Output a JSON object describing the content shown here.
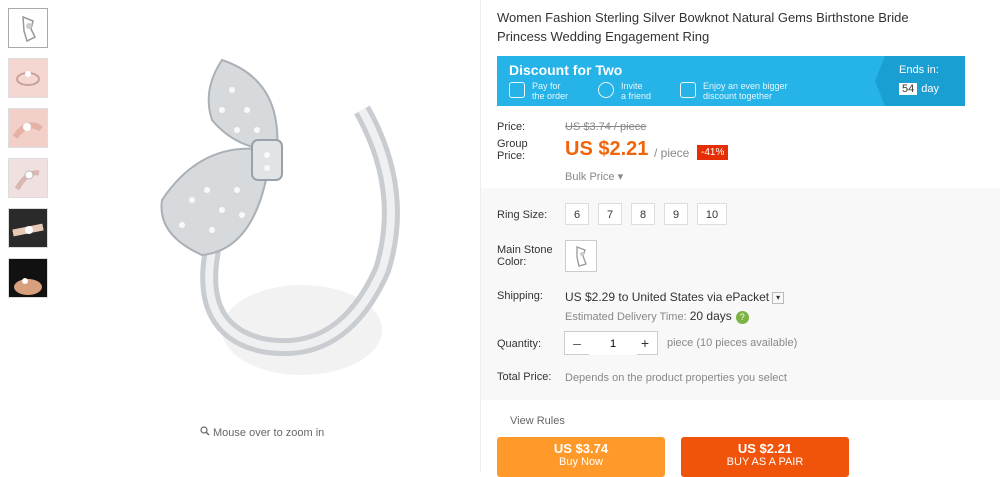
{
  "gallery": {
    "zoom_hint": "Mouse over to zoom in"
  },
  "product": {
    "title": "Women Fashion Sterling Silver Bowknot Natural Gems Birthstone Bride Princess Wedding Engagement Ring"
  },
  "promo": {
    "title": "Discount for Two",
    "steps": [
      {
        "icon": "tag-icon",
        "line1": "Pay for",
        "line2": "the order"
      },
      {
        "icon": "people-icon",
        "line1": "Invite",
        "line2": "a friend"
      },
      {
        "icon": "discount-icon",
        "line1": "Enjoy an even bigger",
        "line2": "discount together"
      }
    ],
    "ends_label": "Ends in:",
    "days_value": "54",
    "days_label": "day",
    "background_color": "#25b3e8"
  },
  "pricing": {
    "price_label": "Price:",
    "original_price": "US $3.74 / piece",
    "group_label": "Group Price:",
    "group_price": "US $2.21",
    "per_piece": "/ piece",
    "discount": "-41%",
    "bulk_price": "Bulk Price ▾",
    "accent_color": "#f0640a"
  },
  "options": {
    "ring_size_label": "Ring Size:",
    "sizes": [
      "6",
      "7",
      "8",
      "9",
      "10"
    ],
    "main_stone_label": "Main Stone Color:"
  },
  "shipping": {
    "label": "Shipping:",
    "text": "US $2.29 to United States via ePacket",
    "delivery_label": "Estimated Delivery Time:",
    "delivery_value": "20 days"
  },
  "quantity": {
    "label": "Quantity:",
    "value": "1",
    "minus": "–",
    "plus": "+",
    "note": "piece (10 pieces available)"
  },
  "total": {
    "label": "Total Price:",
    "note": "Depends on the product properties you select"
  },
  "actions": {
    "view_rules": "View Rules",
    "buy_now_price": "US $3.74",
    "buy_now_label": "Buy Now",
    "pair_price": "US $2.21",
    "pair_label": "BUY AS A PAIR"
  }
}
